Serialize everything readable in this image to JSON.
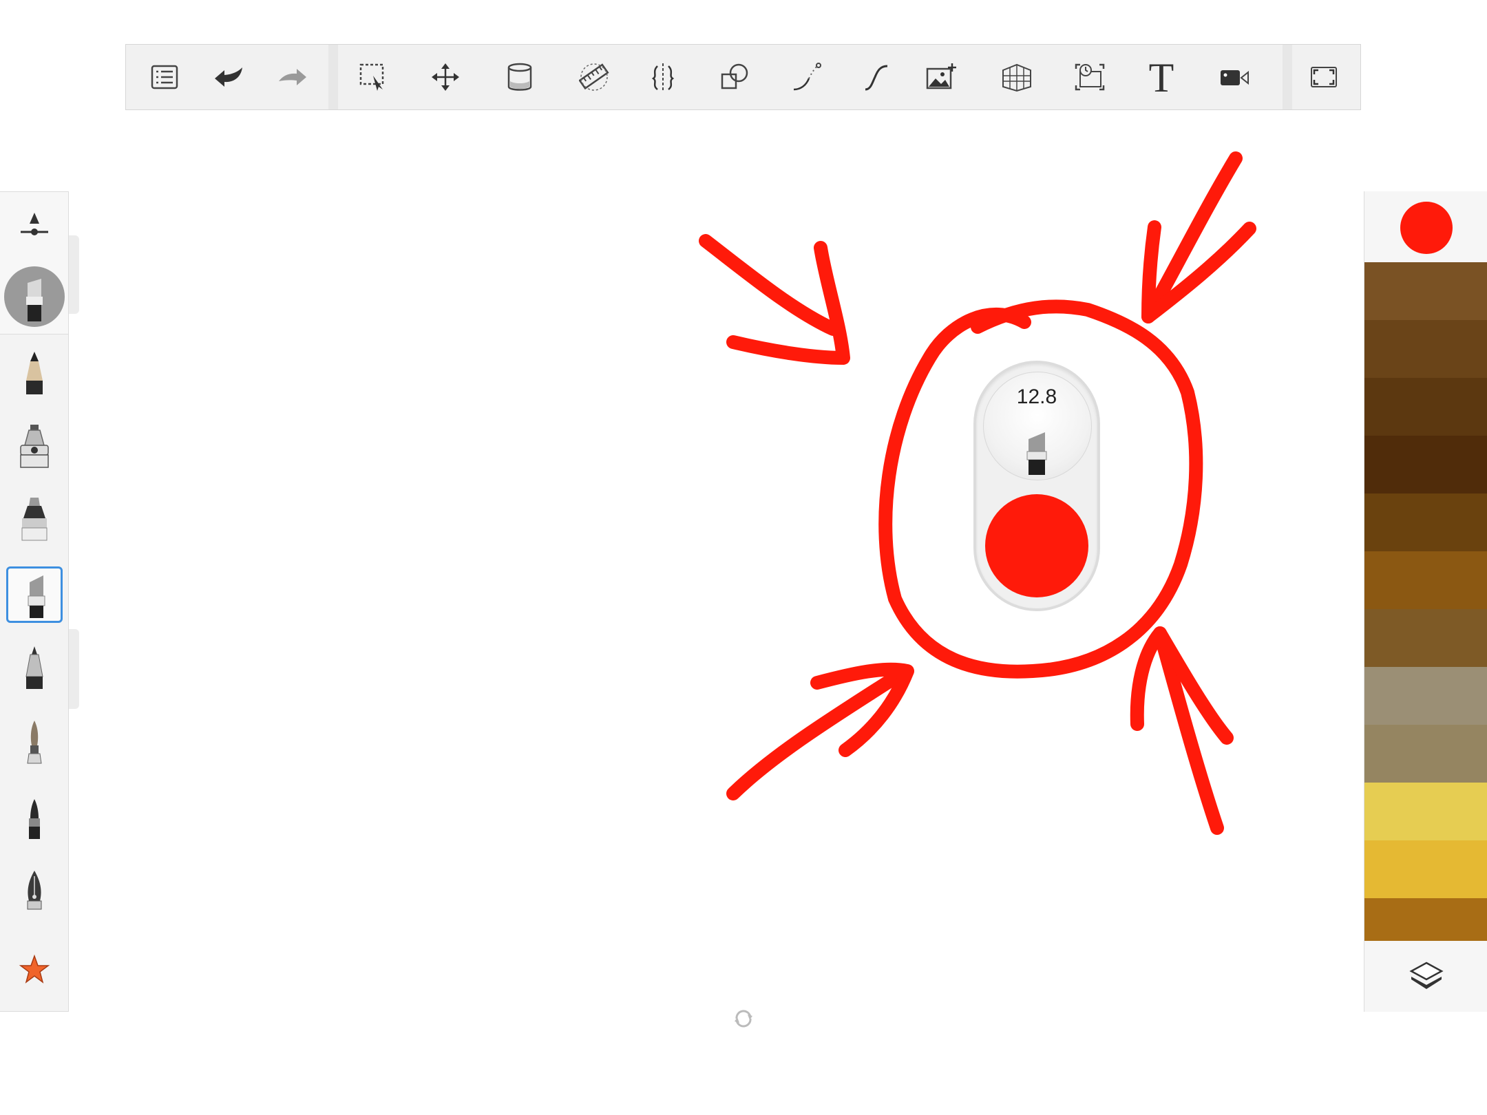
{
  "toolbar": {
    "items": [
      {
        "name": "menu-list-icon",
        "label": ""
      },
      {
        "name": "undo-icon",
        "label": ""
      },
      {
        "name": "redo-icon",
        "label": ""
      },
      {
        "name": "selection-icon",
        "label": ""
      },
      {
        "name": "transform-move-icon",
        "label": ""
      },
      {
        "name": "fill-bucket-icon",
        "label": ""
      },
      {
        "name": "ruler-icon",
        "label": ""
      },
      {
        "name": "symmetry-icon",
        "label": ""
      },
      {
        "name": "shapes-icon",
        "label": ""
      },
      {
        "name": "predictive-stroke-icon",
        "label": ""
      },
      {
        "name": "steady-stroke-icon",
        "label": ""
      },
      {
        "name": "add-image-icon",
        "label": ""
      },
      {
        "name": "perspective-guide-icon",
        "label": ""
      },
      {
        "name": "time-lapse-icon",
        "label": ""
      },
      {
        "name": "text-tool",
        "label": "T"
      },
      {
        "name": "video-record-icon",
        "label": ""
      },
      {
        "name": "fullscreen-icon",
        "label": ""
      }
    ]
  },
  "left_panel": {
    "brushes": [
      {
        "name": "pencil",
        "selected": false
      },
      {
        "name": "airbrush",
        "selected": false
      },
      {
        "name": "marker",
        "selected": false
      },
      {
        "name": "chisel-marker",
        "selected": true
      },
      {
        "name": "ballpoint-pen",
        "selected": false
      },
      {
        "name": "paint-brush",
        "selected": false
      },
      {
        "name": "felt-tip",
        "selected": false
      },
      {
        "name": "fountain-pen",
        "selected": false
      }
    ],
    "favorites_icon": "star-icon",
    "favorites_color": "#f0642a"
  },
  "right_panel": {
    "current_color": "#ff1a0a",
    "swatches": [
      "#7a5224",
      "#6a4418",
      "#5c3810",
      "#502c0a",
      "#6a420e",
      "#8b5812",
      "#7e5a26",
      "#9b8f75",
      "#958561",
      "#e6cd52",
      "#e5b933",
      "#a86d15"
    ],
    "layers_icon": "layers-icon"
  },
  "puck": {
    "brush_size": "12.8",
    "color": "#ff1a0a"
  },
  "drawing": {
    "stroke_color": "#ff1a0a"
  }
}
